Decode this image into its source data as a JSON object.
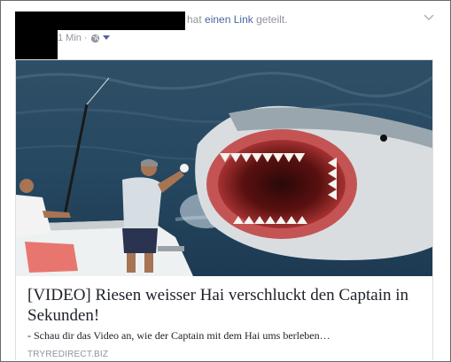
{
  "post": {
    "action_text_1": "hat",
    "action_link": "einen Link",
    "action_text_2": "geteilt.",
    "time": "1 Min",
    "separator": "·"
  },
  "icons": {
    "privacy": "globe-icon",
    "audience_menu": "caret-down-icon",
    "post_menu": "chevron-down-icon"
  },
  "link_card": {
    "title": "[VIDEO] Riesen weisser Hai verschluckt den Captain in Sekunden!",
    "description": "- Schau dir das Video an, wie der Captain mit dem Hai ums berleben…",
    "domain": "TRYREDIRECT.BIZ"
  },
  "colors": {
    "link_blue": "#4a66a0",
    "meta_grey": "#90949c",
    "text_dark": "#1d2129"
  }
}
